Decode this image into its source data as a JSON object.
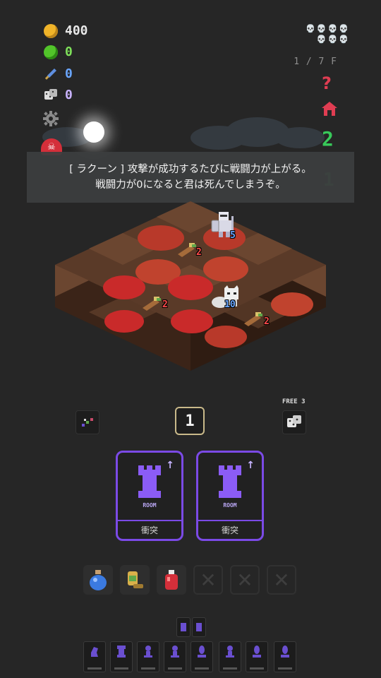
{
  "stats": {
    "gold": "400",
    "bag": "0",
    "weapon": "0",
    "dice": "0",
    "icons": [
      "coin-icon",
      "bag-icon",
      "sword-icon",
      "dice-icon"
    ]
  },
  "header": {
    "floor": "1 / 7 F",
    "help_glyph": "?",
    "green_count": "2",
    "green_faded": "1",
    "skulls": "💀💀💀💀💀💀💀"
  },
  "tooltip": {
    "line1": "[ ラクーン ] 攻撃が成功するたびに戦闘力が上がる。",
    "line2": "戦闘力が0になると君は死んでしまうぞ。"
  },
  "board": {
    "knight_power": "5",
    "raccoon_power": "10",
    "enemy_powers": [
      "2",
      "2",
      "2"
    ]
  },
  "controls": {
    "counter": "1",
    "free_label": "FREE 3"
  },
  "cards": [
    {
      "room": "ROOM",
      "label": "衝突"
    },
    {
      "room": "ROOM",
      "label": "衝突"
    }
  ],
  "items": [
    "blue-potion-icon",
    "lamp-icon",
    "red-potion-icon",
    "empty",
    "empty",
    "empty"
  ],
  "colors": {
    "card_border": "#7b4ae6",
    "tile_red": "#c92a2a",
    "tile_brown": "#5a3a28",
    "danger": "#e03d52",
    "green": "#38c95a"
  }
}
